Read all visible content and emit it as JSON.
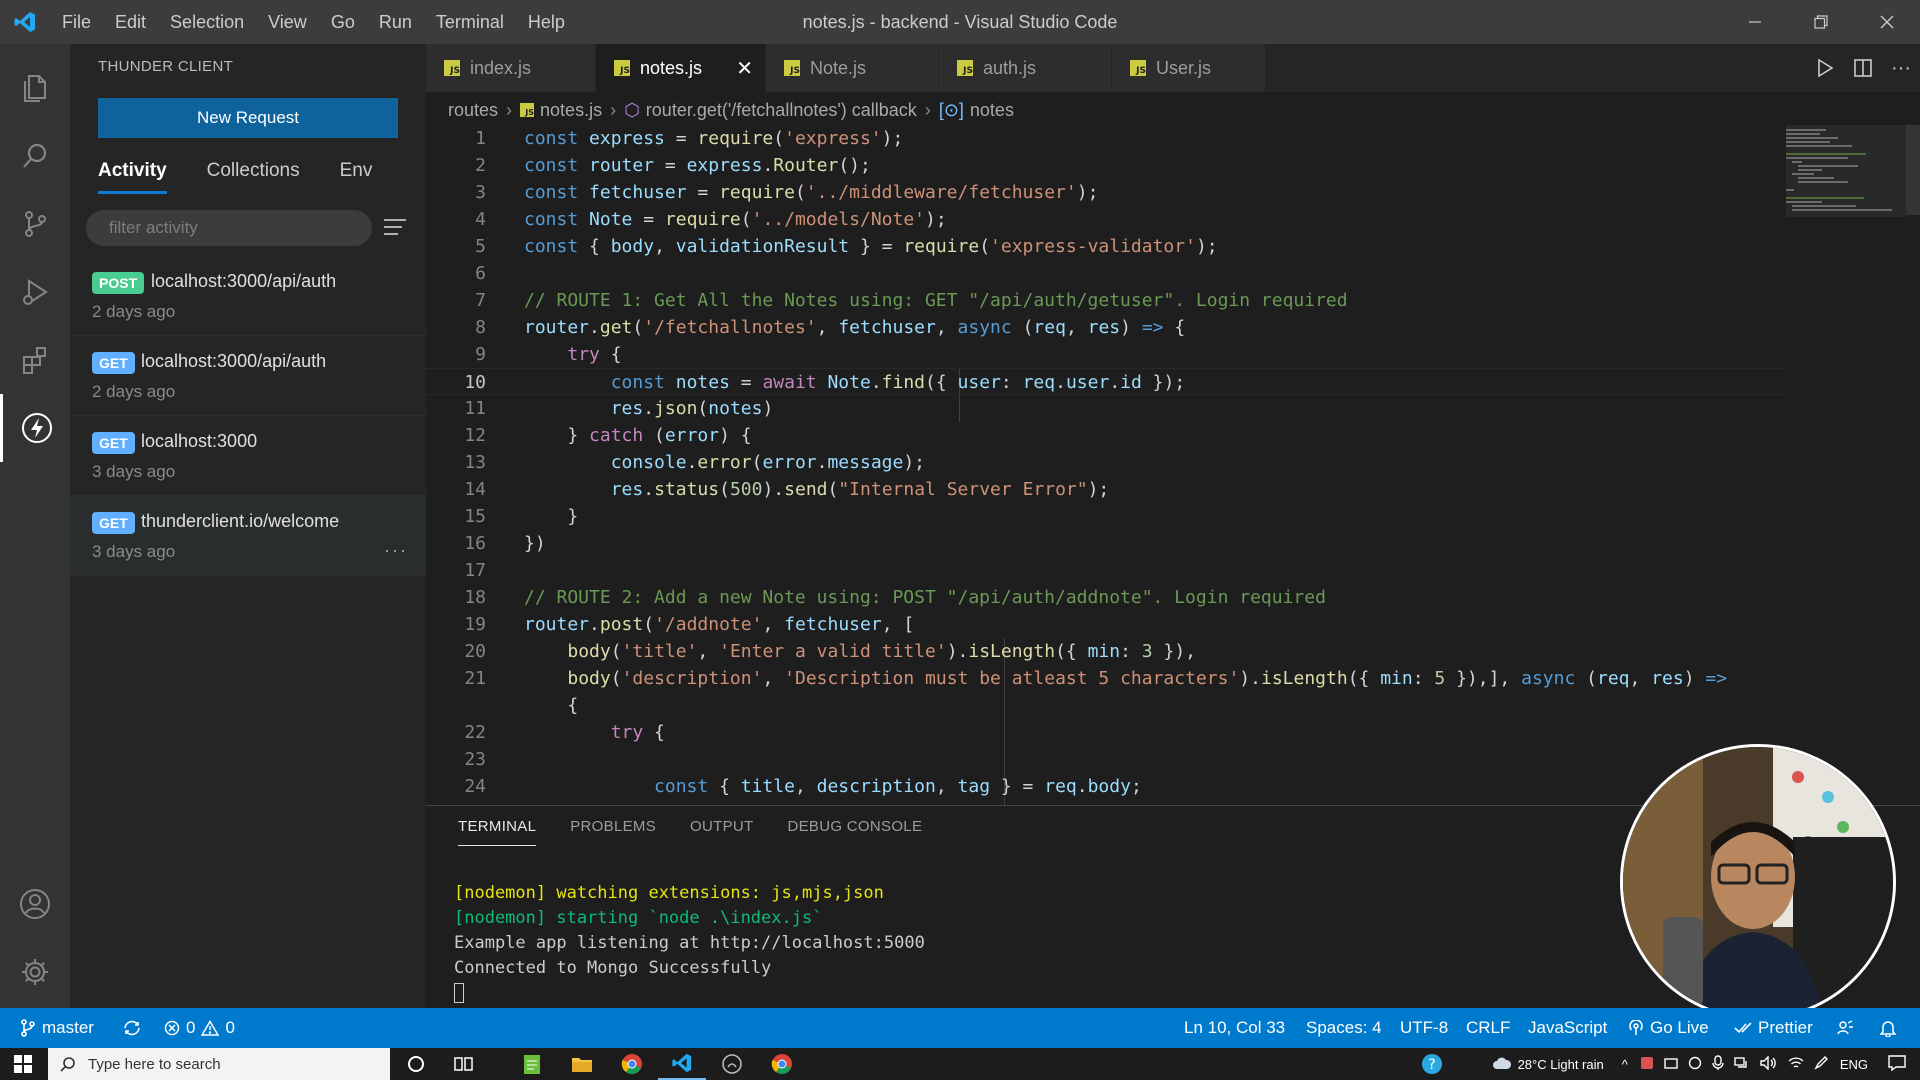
{
  "window": {
    "title": "notes.js - backend - Visual Studio Code",
    "menu": [
      "File",
      "Edit",
      "Selection",
      "View",
      "Go",
      "Run",
      "Terminal",
      "Help"
    ]
  },
  "sidebar": {
    "header": "THUNDER CLIENT",
    "new_request": "New Request",
    "tabs": [
      "Activity",
      "Collections",
      "Env"
    ],
    "filter_placeholder": "filter activity",
    "requests": [
      {
        "method": "POST",
        "url": "localhost:3000/api/auth",
        "when": "2 days ago"
      },
      {
        "method": "GET",
        "url": "localhost:3000/api/auth",
        "when": "2 days ago"
      },
      {
        "method": "GET",
        "url": "localhost:3000",
        "when": "3 days ago"
      },
      {
        "method": "GET",
        "url": "thunderclient.io/welcome",
        "when": "3 days ago"
      }
    ]
  },
  "editor": {
    "tabs": [
      "index.js",
      "notes.js",
      "Note.js",
      "auth.js",
      "User.js"
    ],
    "active_tab": "notes.js",
    "breadcrumb": [
      "routes",
      "notes.js",
      "router.get('/fetchallnotes') callback",
      "notes"
    ],
    "line_numbers": [
      "1",
      "2",
      "3",
      "4",
      "5",
      "6",
      "7",
      "8",
      "9",
      "10",
      "11",
      "12",
      "13",
      "14",
      "15",
      "16",
      "17",
      "18",
      "19",
      "20",
      "21",
      "",
      "22",
      "23",
      "24"
    ],
    "current_line": "10"
  },
  "panel": {
    "tabs": [
      "TERMINAL",
      "PROBLEMS",
      "OUTPUT",
      "DEBUG CONSOLE"
    ],
    "terminal_lines": [
      "[nodemon] watching extensions: js,mjs,json",
      "[nodemon] starting `node .\\index.js`",
      "Example app listening at http://localhost:5000",
      "Connected to Mongo Successfully"
    ]
  },
  "statusbar": {
    "branch": "master",
    "errors": "0",
    "warnings": "0",
    "position": "Ln 10, Col 33",
    "spaces": "Spaces: 4",
    "encoding": "UTF-8",
    "eol": "CRLF",
    "language": "JavaScript",
    "golive": "Go Live",
    "prettier": "Prettier"
  },
  "taskbar": {
    "search_placeholder": "Type here to search",
    "weather": "28°C  Light rain",
    "lang": "ENG"
  },
  "colors": {
    "accent": "#007acc",
    "button": "#0e639c",
    "post_badge": "#49cc90",
    "get_badge": "#61affe"
  }
}
